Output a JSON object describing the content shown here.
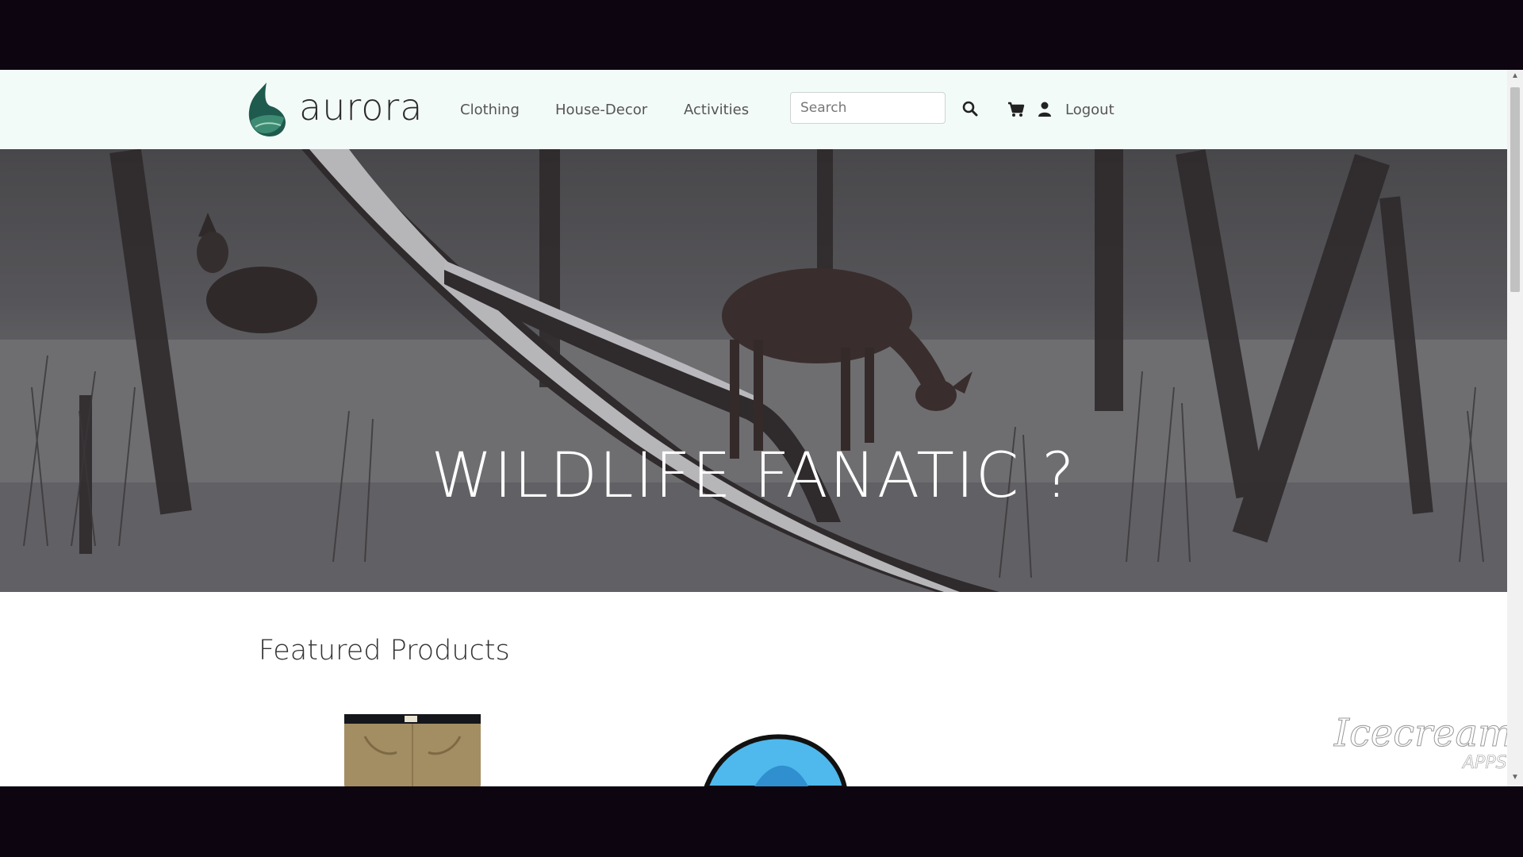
{
  "brand": {
    "name": "aurora",
    "logo_icon": "aurora-logo-icon"
  },
  "nav": {
    "links": [
      {
        "label": "Clothing"
      },
      {
        "label": "House-Decor"
      },
      {
        "label": "Activities"
      }
    ],
    "search": {
      "placeholder": "Search",
      "value": ""
    },
    "icons": {
      "search": "search-icon",
      "cart": "cart-icon",
      "user": "user-icon"
    },
    "logout_label": "Logout"
  },
  "hero": {
    "title": "WILDLIFE FANATIC ?"
  },
  "featured": {
    "title": "Featured Products",
    "products": [
      {
        "image": "khaki-pants"
      },
      {
        "image": "blue-popup-tent"
      }
    ]
  },
  "watermark": {
    "text_main": "Icecream",
    "text_sub": "APPS"
  },
  "colors": {
    "navbar_bg": "#f3fbf9",
    "accent_teal": "#1e5a4e"
  }
}
